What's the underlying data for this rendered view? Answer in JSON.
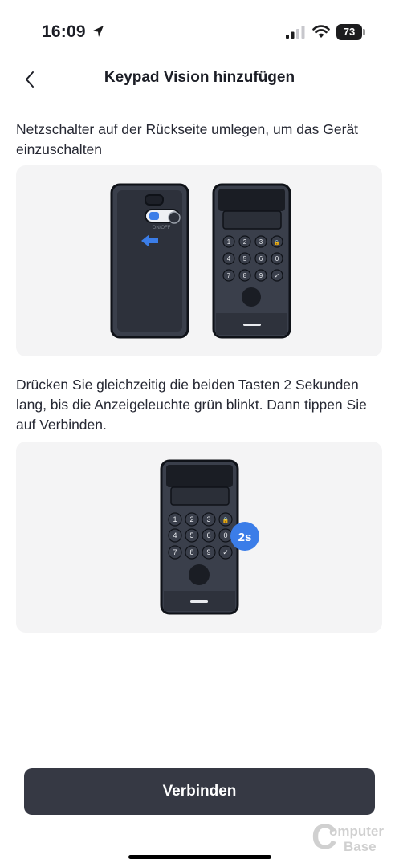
{
  "status_bar": {
    "time": "16:09",
    "battery": "73"
  },
  "nav": {
    "title": "Keypad Vision hinzufügen"
  },
  "steps": [
    {
      "text": "Netzschalter auf der Rückseite umlegen, um das Gerät einzuschalten",
      "switch_label": "ON/OFF"
    },
    {
      "text": "Drücken Sie gleichzeitig die beiden Tasten 2 Sekunden lang, bis die Anzeigeleuchte grün blinkt. Dann tippen Sie auf Verbinden.",
      "badge": "2s"
    }
  ],
  "keypad_keys": [
    "1",
    "2",
    "3",
    "🔒",
    "4",
    "5",
    "6",
    "0",
    "7",
    "8",
    "9",
    "✓"
  ],
  "footer": {
    "connect_label": "Verbinden"
  },
  "watermark": {
    "line1": "omputer",
    "line2": "Base",
    "mark": "C"
  },
  "colors": {
    "device_body": "#3a3f4b",
    "device_outline": "#0f1218",
    "accent_blue": "#3b7de8",
    "button_bg": "#363944"
  }
}
